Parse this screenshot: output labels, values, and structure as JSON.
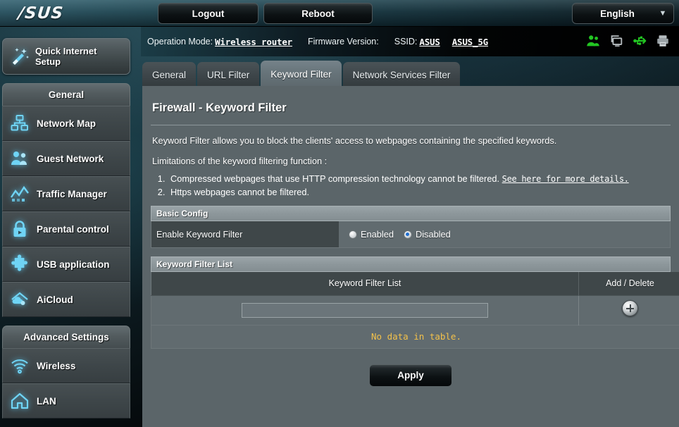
{
  "topbar": {
    "logo": "/SUS",
    "logout_label": "Logout",
    "reboot_label": "Reboot",
    "language": "English"
  },
  "infostrip": {
    "operation_mode_label": "Operation Mode:",
    "operation_mode_value": "Wireless router",
    "firmware_label": "Firmware Version:",
    "firmware_value": "",
    "ssid_label": "SSID:",
    "ssid_1": "ASUS",
    "ssid_2": "ASUS_5G",
    "icons": [
      "clients-icon",
      "devices-icon",
      "usb-icon",
      "printer-icon"
    ]
  },
  "sidebar": {
    "quick_setup": {
      "label_line1": "Quick Internet",
      "label_line2": "Setup",
      "icon": "wand-icon"
    },
    "general_header": "General",
    "general_items": [
      {
        "label": "Network Map",
        "icon": "network-map-icon"
      },
      {
        "label": "Guest Network",
        "icon": "users-icon"
      },
      {
        "label": "Traffic Manager",
        "icon": "chart-icon"
      },
      {
        "label": "Parental control",
        "icon": "lock-icon"
      },
      {
        "label": "USB application",
        "icon": "puzzle-icon"
      },
      {
        "label": "AiCloud",
        "icon": "cloud-icon"
      }
    ],
    "advanced_header": "Advanced Settings",
    "advanced_items": [
      {
        "label": "Wireless",
        "icon": "wifi-icon"
      },
      {
        "label": "LAN",
        "icon": "home-icon"
      }
    ]
  },
  "tabs": [
    {
      "label": "General",
      "active": false
    },
    {
      "label": "URL Filter",
      "active": false
    },
    {
      "label": "Keyword Filter",
      "active": true
    },
    {
      "label": "Network Services Filter",
      "active": false
    }
  ],
  "main": {
    "page_title": "Firewall - Keyword Filter",
    "description": "Keyword Filter allows you to block the clients' access to webpages containing the specified keywords.",
    "limitations_header": "Limitations of the keyword filtering function :",
    "limitation_1": "Compressed webpages that use HTTP compression technology cannot be filtered.",
    "limitation_1_link": "See here for more details.",
    "limitation_2": "Https webpages cannot be filtered.",
    "basic_config_header": "Basic Config",
    "enable_label": "Enable Keyword Filter",
    "radio_enabled_label": "Enabled",
    "radio_disabled_label": "Disabled",
    "selected_radio": "Disabled",
    "list_section_header": "Keyword Filter List",
    "table_col_keyword": "Keyword Filter List",
    "table_col_action": "Add / Delete",
    "keyword_input_value": "",
    "keyword_input_placeholder": "",
    "add_icon": "plus-circle-icon",
    "no_data_text": "No data in table.",
    "apply_label": "Apply"
  },
  "colors": {
    "panel_bg": "#5b6569",
    "section_header_bg": "#8d979b",
    "label_cell_bg": "#3f4749",
    "value_cell_bg": "#616b6f",
    "accent_cyan": "#5ac8f0",
    "warning_yellow": "#f2c14b",
    "status_green": "#22c522"
  }
}
